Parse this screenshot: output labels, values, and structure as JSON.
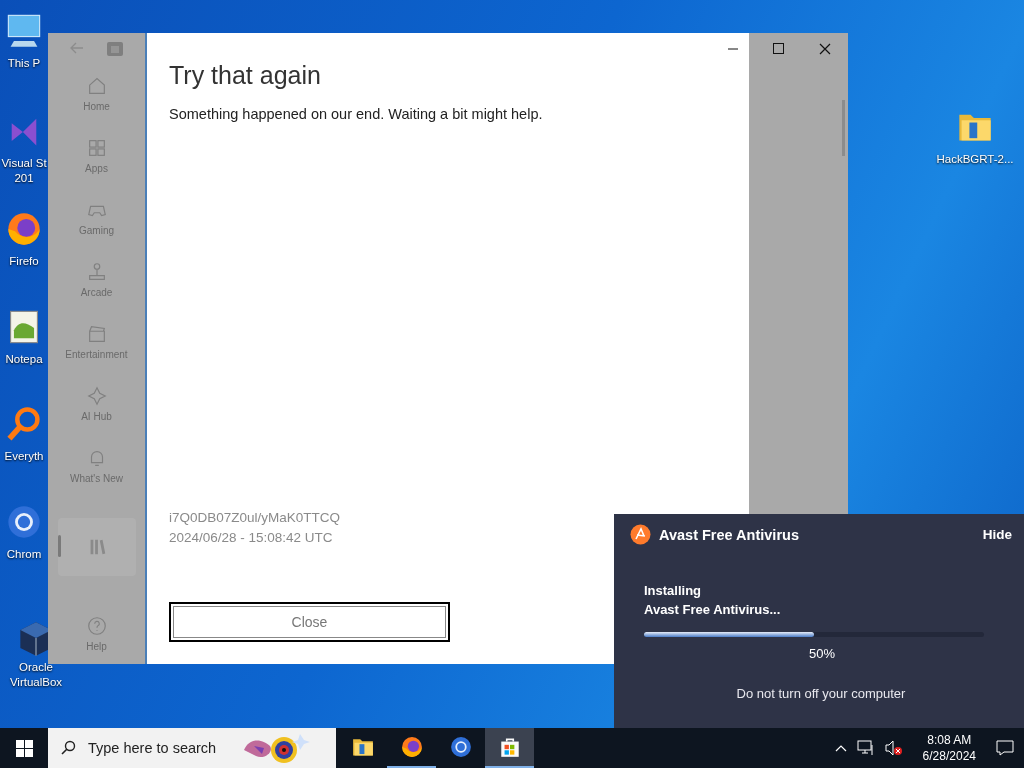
{
  "desktop_icons": [
    {
      "kind": "monitor",
      "lines": [
        "This P"
      ]
    },
    {
      "kind": "vs",
      "lines": [
        "Visual St",
        "201"
      ]
    },
    {
      "kind": "firefox",
      "lines": [
        "Firefo"
      ]
    },
    {
      "kind": "notepad",
      "lines": [
        "Notepa"
      ]
    },
    {
      "kind": "magnifier",
      "lines": [
        "Everyth"
      ]
    },
    {
      "kind": "chrome",
      "lines": [
        "Chrom"
      ]
    },
    {
      "kind": "cube",
      "lines": [
        "Oracle",
        "VirtualBox"
      ]
    },
    {
      "kind": "folder",
      "lines": [
        "HackBGRT-2..."
      ]
    }
  ],
  "store_window": {
    "sidebar": {
      "items": [
        {
          "kind": "home",
          "label": "Home",
          "selected": false
        },
        {
          "kind": "apps",
          "label": "Apps",
          "selected": false
        },
        {
          "kind": "gaming",
          "label": "Gaming",
          "selected": false
        },
        {
          "kind": "arcade",
          "label": "Arcade",
          "selected": false
        },
        {
          "kind": "entertainment",
          "label": "Entertainment",
          "selected": false
        },
        {
          "kind": "ai",
          "label": "AI Hub",
          "selected": false
        },
        {
          "kind": "whatsnew",
          "label": "What's New",
          "selected": false
        },
        {
          "kind": "library",
          "selected": true
        },
        {
          "kind": "help",
          "label": "Help",
          "selected": false
        }
      ]
    },
    "dialog": {
      "title": "Try that again",
      "message": "Something happened on our end. Waiting a bit might help.",
      "error_code": "i7Q0DB07Z0ul/yMaK0TTCQ",
      "timestamp": "2024/06/28 - 15:08:42 UTC",
      "close_button": "Close"
    }
  },
  "avast_popup": {
    "title": "Avast Free Antivirus",
    "hide_button": "Hide",
    "status": [
      "Installing",
      "Avast Free Antivirus..."
    ],
    "progress": {
      "level": 0.5
    },
    "percent": "50%",
    "note": "Do not turn off your computer"
  },
  "taskbar": {
    "search": {
      "placeholder": "Type here to search"
    },
    "apps": [
      {
        "kind": "folder",
        "running": false,
        "focused": false
      },
      {
        "kind": "firefox",
        "running": true,
        "focused": false
      },
      {
        "kind": "chrome",
        "running": false,
        "focused": false
      },
      {
        "kind": "store",
        "running": true,
        "focused": true
      }
    ],
    "time": "8:08 AM",
    "date": "6/28/2024"
  }
}
